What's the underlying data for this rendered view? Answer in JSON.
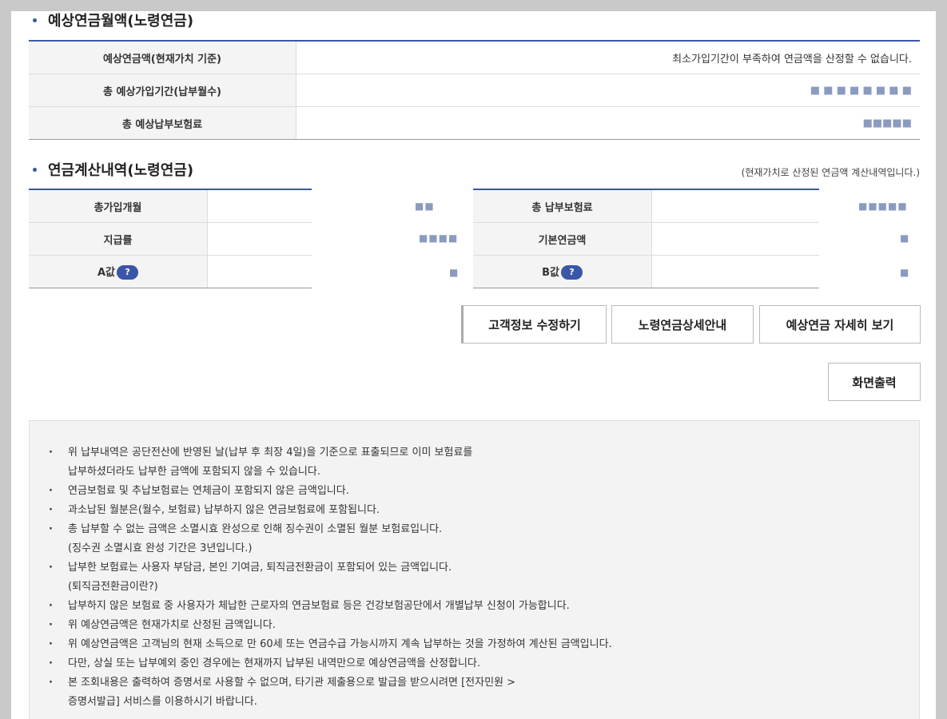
{
  "section1": {
    "title": "예상연금월액(노령연금)",
    "rows": [
      {
        "label": "예상연금액(현재가치 기준)",
        "value": "최소가입기간이 부족하여 연금액을 산정할 수 없습니다."
      },
      {
        "label": "총 예상가입기간(납부월수)",
        "value": "■ ■ ■ ■ ■ ■ ■ ■"
      },
      {
        "label": "총 예상납부보험료",
        "value": "■■■■■"
      }
    ]
  },
  "section2": {
    "title": "연금계산내역(노령연금)",
    "note": "(현재가치로 산정된 연금액 계산내역입니다.)",
    "left_rows": [
      {
        "label": "총가입개월",
        "value": "■■"
      },
      {
        "label": "지급률",
        "value": "■■■■"
      },
      {
        "label": "A값",
        "help": "?",
        "value": "■"
      }
    ],
    "right_rows": [
      {
        "label": "총 납부보험료",
        "value": "■■■■■"
      },
      {
        "label": "기본연금액",
        "value": "■"
      },
      {
        "label": "B값",
        "help": "?",
        "value": "■"
      }
    ]
  },
  "buttons": {
    "edit_customer": "고객정보 수정하기",
    "pension_guide": "노령연금상세안내",
    "pension_detail": "예상연금 자세히 보기",
    "print": "화면출력"
  },
  "notices": [
    {
      "text": "위 납부내역은 공단전산에 반영된 날(납부 후 최장 4일)을 기준으로 표출되므로 이미 보험료를",
      "cont": false
    },
    {
      "text": "납부하셨더라도 납부한 금액에 포함되지 않을 수 있습니다.",
      "cont": true
    },
    {
      "text": "연금보험료 및 추납보험료는 연체금이 포함되지 않은 금액입니다.",
      "cont": false
    },
    {
      "text": "과소납된 월분은(월수, 보험료) 납부하지 않은 연금보험료에 포함됩니다.",
      "cont": false
    },
    {
      "text": "총 납부할 수 없는 금액은 소멸시효 완성으로 인해 징수권이 소멸된 월분 보험료입니다.",
      "cont": false
    },
    {
      "text": "(징수권 소멸시효 완성 기간은 3년입니다.)",
      "cont": true
    },
    {
      "text": "납부한 보험료는 사용자 부담금, 본인 기여금, 퇴직금전환금이 포함되어 있는 금액입니다.",
      "cont": false
    },
    {
      "text": "(퇴직금전환금이란?)",
      "cont": true
    },
    {
      "text": "납부하지 않은 보험료 중 사용자가 체납한 근로자의 연금보험료 등은 건강보험공단에서 개별납부 신청이 가능합니다.",
      "cont": false
    },
    {
      "text": "위 예상연금액은 현재가치로 산정된 금액입니다.",
      "cont": false
    },
    {
      "text": "위 예상연금액은 고객님의 현재 소득으로 만 60세 또는 연금수급 가능시까지 계속 납부하는 것을 가정하여 계산된 금액입니다.",
      "cont": false
    },
    {
      "text": "다만, 상실 또는 납부예외 중인 경우에는 현재까지 납부된 내역만으로 예상연금액을 산정합니다.",
      "cont": false
    },
    {
      "text": "본 조회내용은 출력하여 증명서로 사용할 수 없으며, 타기관 제출용으로 발급을 받으시려면 [전자민원 >",
      "cont": false
    },
    {
      "text": "증명서발급] 서비스를 이용하시기 바랍니다.",
      "cont": true
    }
  ]
}
